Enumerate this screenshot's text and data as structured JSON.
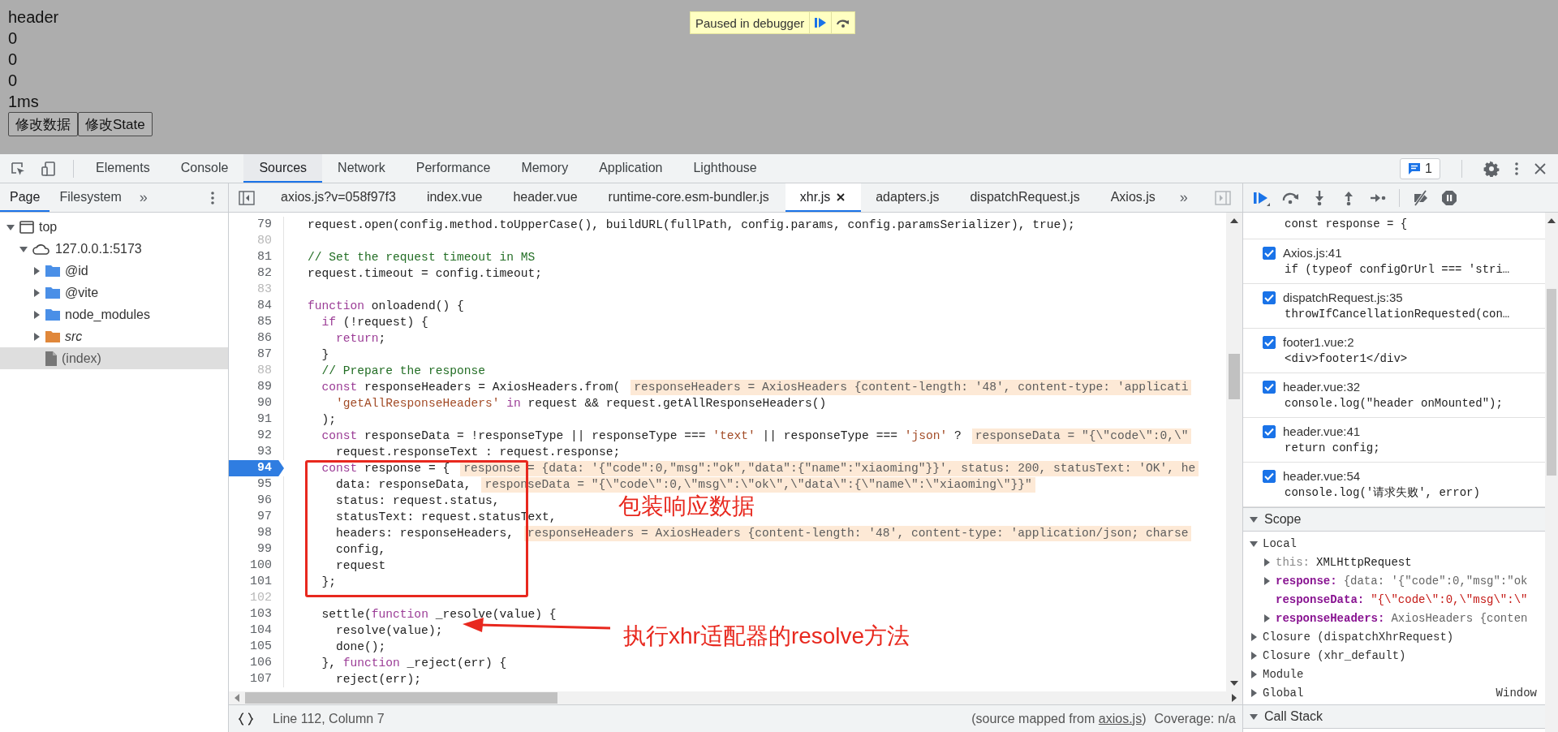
{
  "page": {
    "lines": [
      "header",
      "0",
      "0",
      "0",
      "1ms"
    ],
    "buttons": [
      "修改数据",
      "修改State"
    ]
  },
  "paused_banner": {
    "text": "Paused in debugger"
  },
  "devtools": {
    "tabs": [
      {
        "label": "Elements",
        "selected": false
      },
      {
        "label": "Console",
        "selected": false
      },
      {
        "label": "Sources",
        "selected": true
      },
      {
        "label": "Network",
        "selected": false
      },
      {
        "label": "Performance",
        "selected": false
      },
      {
        "label": "Memory",
        "selected": false
      },
      {
        "label": "Application",
        "selected": false
      },
      {
        "label": "Lighthouse",
        "selected": false
      }
    ],
    "issues_count": "1"
  },
  "navigator": {
    "tabs": [
      {
        "label": "Page",
        "selected": true
      },
      {
        "label": "Filesystem",
        "selected": false
      }
    ],
    "more": "»",
    "tree": [
      {
        "label": "top",
        "kind": "frame",
        "expanded": true,
        "selected": false,
        "children": [
          {
            "label": "127.0.0.1:5173",
            "kind": "origin",
            "expanded": true,
            "selected": false,
            "children": [
              {
                "label": "@id",
                "kind": "folder",
                "expanded": false,
                "selected": false
              },
              {
                "label": "@vite",
                "kind": "folder",
                "expanded": false,
                "selected": false
              },
              {
                "label": "node_modules",
                "kind": "folder",
                "expanded": false,
                "selected": false
              },
              {
                "label": "src",
                "kind": "mapped-folder",
                "expanded": false,
                "selected": false
              },
              {
                "label": "(index)",
                "kind": "file",
                "selected": true
              }
            ]
          }
        ]
      }
    ]
  },
  "editor": {
    "tabs": [
      {
        "label": "axios.js?v=058f97f3",
        "selected": false,
        "closable": false
      },
      {
        "label": "index.vue",
        "selected": false,
        "closable": false
      },
      {
        "label": "header.vue",
        "selected": false,
        "closable": false
      },
      {
        "label": "runtime-core.esm-bundler.js",
        "selected": false,
        "closable": false
      },
      {
        "label": "xhr.js",
        "selected": true,
        "closable": true
      },
      {
        "label": "adapters.js",
        "selected": false,
        "closable": false
      },
      {
        "label": "dispatchRequest.js",
        "selected": false,
        "closable": false
      },
      {
        "label": "Axios.js",
        "selected": false,
        "closable": false
      }
    ],
    "more": "»",
    "lines": [
      {
        "number": "79",
        "breakable": true,
        "paused": false,
        "tokens": [
          {
            "kind": "plain",
            "text": "request.open(config.method.toUpperCase(), buildURL(fullPath, config.params, config.paramsSerializer), true);"
          }
        ]
      },
      {
        "number": "80",
        "breakable": false,
        "paused": false
      },
      {
        "number": "81",
        "breakable": true,
        "paused": false,
        "tokens": [
          {
            "kind": "comment",
            "text": "// Set the request timeout in MS"
          }
        ]
      },
      {
        "number": "82",
        "breakable": true,
        "paused": false,
        "tokens": [
          {
            "kind": "plain",
            "text": "request.timeout = config.timeout;"
          }
        ]
      },
      {
        "number": "83",
        "breakable": false,
        "paused": false
      },
      {
        "number": "84",
        "breakable": true,
        "paused": false,
        "tokens": [
          {
            "kind": "keyword",
            "text": "function"
          },
          {
            "kind": "plain",
            "text": " onloadend() {"
          }
        ]
      },
      {
        "number": "85",
        "breakable": true,
        "paused": false,
        "tokens": [
          {
            "kind": "keyword",
            "text": "  if"
          },
          {
            "kind": "plain",
            "text": " (!request) {"
          }
        ]
      },
      {
        "number": "86",
        "breakable": true,
        "paused": false,
        "tokens": [
          {
            "kind": "keyword",
            "text": "    return"
          },
          {
            "kind": "plain",
            "text": ";"
          }
        ]
      },
      {
        "number": "87",
        "breakable": true,
        "paused": false,
        "tokens": [
          {
            "kind": "plain",
            "text": "  }"
          }
        ]
      },
      {
        "number": "88",
        "breakable": false,
        "paused": false,
        "tokens": [
          {
            "kind": "comment",
            "text": "  // Prepare the response"
          }
        ]
      },
      {
        "number": "89",
        "breakable": true,
        "paused": false,
        "tokens": [
          {
            "kind": "keyword",
            "text": "  const"
          },
          {
            "kind": "plain",
            "text": " responseHeaders = AxiosHeaders.from("
          }
        ],
        "inline_value": "responseHeaders = AxiosHeaders {content-length: '48', content-type: 'applicati"
      },
      {
        "number": "90",
        "breakable": true,
        "paused": false,
        "tokens": [
          {
            "kind": "string",
            "text": "    'getAllResponseHeaders'"
          },
          {
            "kind": "keyword",
            "text": " in"
          },
          {
            "kind": "plain",
            "text": " request && request.getAllResponseHeaders()"
          }
        ]
      },
      {
        "number": "91",
        "breakable": true,
        "paused": false,
        "tokens": [
          {
            "kind": "plain",
            "text": "  );"
          }
        ]
      },
      {
        "number": "92",
        "breakable": true,
        "paused": false,
        "tokens": [
          {
            "kind": "keyword",
            "text": "  const"
          },
          {
            "kind": "plain",
            "text": " responseData = !responseType || responseType === "
          },
          {
            "kind": "string",
            "text": "'text'"
          },
          {
            "kind": "plain",
            "text": " || responseType === "
          },
          {
            "kind": "string",
            "text": "'json'"
          },
          {
            "kind": "plain",
            "text": " ?"
          }
        ],
        "inline_value": "responseData = \"{\\\"code\\\":0,\\\""
      },
      {
        "number": "93",
        "breakable": true,
        "paused": false,
        "tokens": [
          {
            "kind": "plain",
            "text": "    request.responseText : request.response;"
          }
        ]
      },
      {
        "number": "94",
        "breakable": true,
        "paused": true,
        "tokens": [
          {
            "kind": "keyword",
            "text": "  const"
          },
          {
            "kind": "plain",
            "text": " response = {"
          }
        ],
        "inline_value": "response = {data: '{\"code\":0,\"msg\":\"ok\",\"data\":{\"name\":\"xiaoming\"}}', status: 200, statusText: 'OK', he"
      },
      {
        "number": "95",
        "breakable": true,
        "paused": false,
        "tokens": [
          {
            "kind": "plain",
            "text": "    data: responseData,"
          }
        ],
        "inline_value": "responseData = \"{\\\"code\\\":0,\\\"msg\\\":\\\"ok\\\",\\\"data\\\":{\\\"name\\\":\\\"xiaoming\\\"}}\""
      },
      {
        "number": "96",
        "breakable": true,
        "paused": false,
        "tokens": [
          {
            "kind": "plain",
            "text": "    status: request.status,"
          }
        ]
      },
      {
        "number": "97",
        "breakable": true,
        "paused": false,
        "tokens": [
          {
            "kind": "plain",
            "text": "    statusText: request.statusText,"
          }
        ]
      },
      {
        "number": "98",
        "breakable": true,
        "paused": false,
        "tokens": [
          {
            "kind": "plain",
            "text": "    headers: responseHeaders,"
          }
        ],
        "inline_value": "responseHeaders = AxiosHeaders {content-length: '48', content-type: 'application/json; charse"
      },
      {
        "number": "99",
        "breakable": true,
        "paused": false,
        "tokens": [
          {
            "kind": "plain",
            "text": "    config,"
          }
        ]
      },
      {
        "number": "100",
        "breakable": true,
        "paused": false,
        "tokens": [
          {
            "kind": "plain",
            "text": "    request"
          }
        ]
      },
      {
        "number": "101",
        "breakable": true,
        "paused": false,
        "tokens": [
          {
            "kind": "plain",
            "text": "  };"
          }
        ]
      },
      {
        "number": "102",
        "breakable": false,
        "paused": false
      },
      {
        "number": "103",
        "breakable": true,
        "paused": false,
        "tokens": [
          {
            "kind": "plain",
            "text": "  settle("
          },
          {
            "kind": "keyword",
            "text": "function"
          },
          {
            "kind": "plain",
            "text": " _resolve(value) {"
          }
        ]
      },
      {
        "number": "104",
        "breakable": true,
        "paused": false,
        "tokens": [
          {
            "kind": "plain",
            "text": "    resolve(value);"
          }
        ]
      },
      {
        "number": "105",
        "breakable": true,
        "paused": false,
        "tokens": [
          {
            "kind": "plain",
            "text": "    done();"
          }
        ]
      },
      {
        "number": "106",
        "breakable": true,
        "paused": false,
        "tokens": [
          {
            "kind": "plain",
            "text": "  }, "
          },
          {
            "kind": "keyword",
            "text": "function"
          },
          {
            "kind": "plain",
            "text": " _reject(err) {"
          }
        ]
      },
      {
        "number": "107",
        "breakable": true,
        "paused": false,
        "tokens": [
          {
            "kind": "plain",
            "text": "    reject(err);"
          }
        ]
      }
    ],
    "annotations": {
      "box_label": "包装响应数据",
      "arrow_label": "执行xhr适配器的resolve方法"
    },
    "status_bar": {
      "position": "Line 112, Column 7",
      "source_prefix": "(source mapped from ",
      "source_link": "axios.js",
      "source_suffix": ")",
      "coverage": "Coverage: n/a"
    }
  },
  "debugger": {
    "partial_breakpoint_code": "const response = {",
    "breakpoints": [
      {
        "location": "Axios.js:41",
        "code": "if (typeof configOrUrl === 'stri…",
        "checked": true
      },
      {
        "location": "dispatchRequest.js:35",
        "code": "throwIfCancellationRequested(con…",
        "checked": true
      },
      {
        "location": "footer1.vue:2",
        "code": "<div>footer1</div>",
        "checked": true
      },
      {
        "location": "header.vue:32",
        "code": "console.log(\"header onMounted\");",
        "checked": true
      },
      {
        "location": "header.vue:41",
        "code": "return config;",
        "checked": true
      },
      {
        "location": "header.vue:54",
        "code": "console.log('请求失败', error)",
        "checked": true
      }
    ],
    "scope": {
      "title": "Scope",
      "expanded": true,
      "groups": [
        {
          "label": "Local",
          "expanded": true,
          "entries": [
            {
              "name": "this:",
              "kind": "receiver",
              "value": {
                "kind": "plain",
                "text": "XMLHttpRequest"
              },
              "expandable": true
            },
            {
              "name": "response:",
              "kind": "variable",
              "value": {
                "kind": "object",
                "text": "{data: '{\"code\":0,\"msg\":\"ok"
              },
              "expandable": true
            },
            {
              "name": "responseData:",
              "kind": "variable",
              "value": {
                "kind": "string",
                "text": "\"{\\\"code\\\":0,\\\"msg\\\":\\\""
              },
              "expandable": false
            },
            {
              "name": "responseHeaders:",
              "kind": "variable",
              "value": {
                "kind": "object",
                "text": "AxiosHeaders {conten"
              },
              "expandable": true
            }
          ]
        },
        {
          "label": "Closure (dispatchXhrRequest)",
          "expanded": false
        },
        {
          "label": "Closure (xhr_default)",
          "expanded": false
        },
        {
          "label": "Module",
          "expanded": false
        },
        {
          "label": "Global",
          "expanded": false,
          "value": "Window"
        }
      ]
    },
    "call_stack": {
      "title": "Call Stack",
      "expanded": true
    }
  }
}
